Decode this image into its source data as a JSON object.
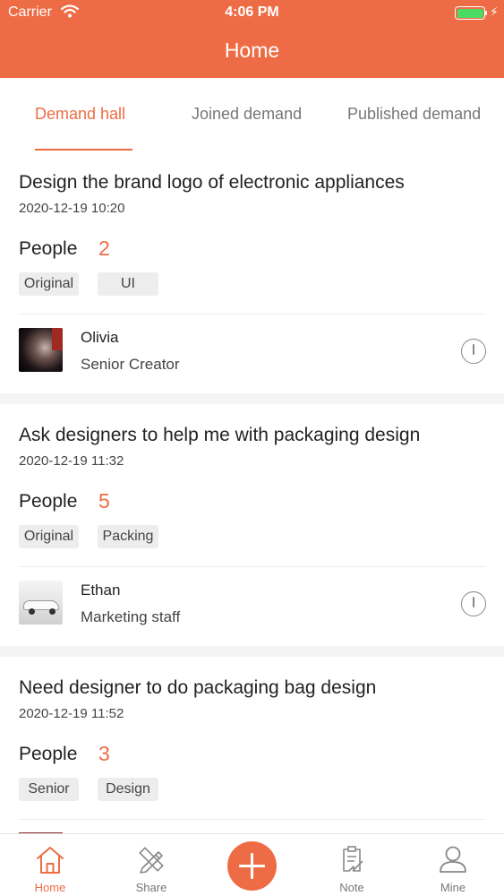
{
  "status_bar": {
    "carrier": "Carrier",
    "time": "4:06 PM"
  },
  "header": {
    "title": "Home"
  },
  "tabs": [
    {
      "label": "Demand hall",
      "active": true
    },
    {
      "label": "Joined demand",
      "active": false
    },
    {
      "label": "Published demand",
      "active": false
    }
  ],
  "demands": [
    {
      "title": "Design the brand logo of electronic appliances",
      "datetime": "2020-12-19 10:20",
      "people_label": "People",
      "people_count": "2",
      "tags": [
        "Original",
        "UI"
      ],
      "user": {
        "name": "Olivia",
        "role": "Senior Creator"
      }
    },
    {
      "title": "Ask designers to help me with packaging design",
      "datetime": "2020-12-19 11:32",
      "people_label": "People",
      "people_count": "5",
      "tags": [
        "Original",
        "Packing"
      ],
      "user": {
        "name": "Ethan",
        "role": "Marketing staff"
      }
    },
    {
      "title": "Need designer to do packaging bag design",
      "datetime": "2020-12-19 11:52",
      "people_label": "People",
      "people_count": "3",
      "tags": [
        "Senior",
        "Design"
      ]
    }
  ],
  "tabbar": {
    "items": [
      {
        "label": "Home",
        "icon": "home-icon",
        "active": true
      },
      {
        "label": "Share",
        "icon": "pencil-ruler-icon",
        "active": false
      },
      {
        "label": "",
        "icon": "plus-icon",
        "active": false
      },
      {
        "label": "Note",
        "icon": "clipboard-icon",
        "active": false
      },
      {
        "label": "Mine",
        "icon": "user-icon",
        "active": false
      }
    ]
  },
  "colors": {
    "accent": "#EE6C45",
    "battery": "#4CD964",
    "tag_bg": "#EDEDED",
    "separator": "#F4F4F4"
  }
}
